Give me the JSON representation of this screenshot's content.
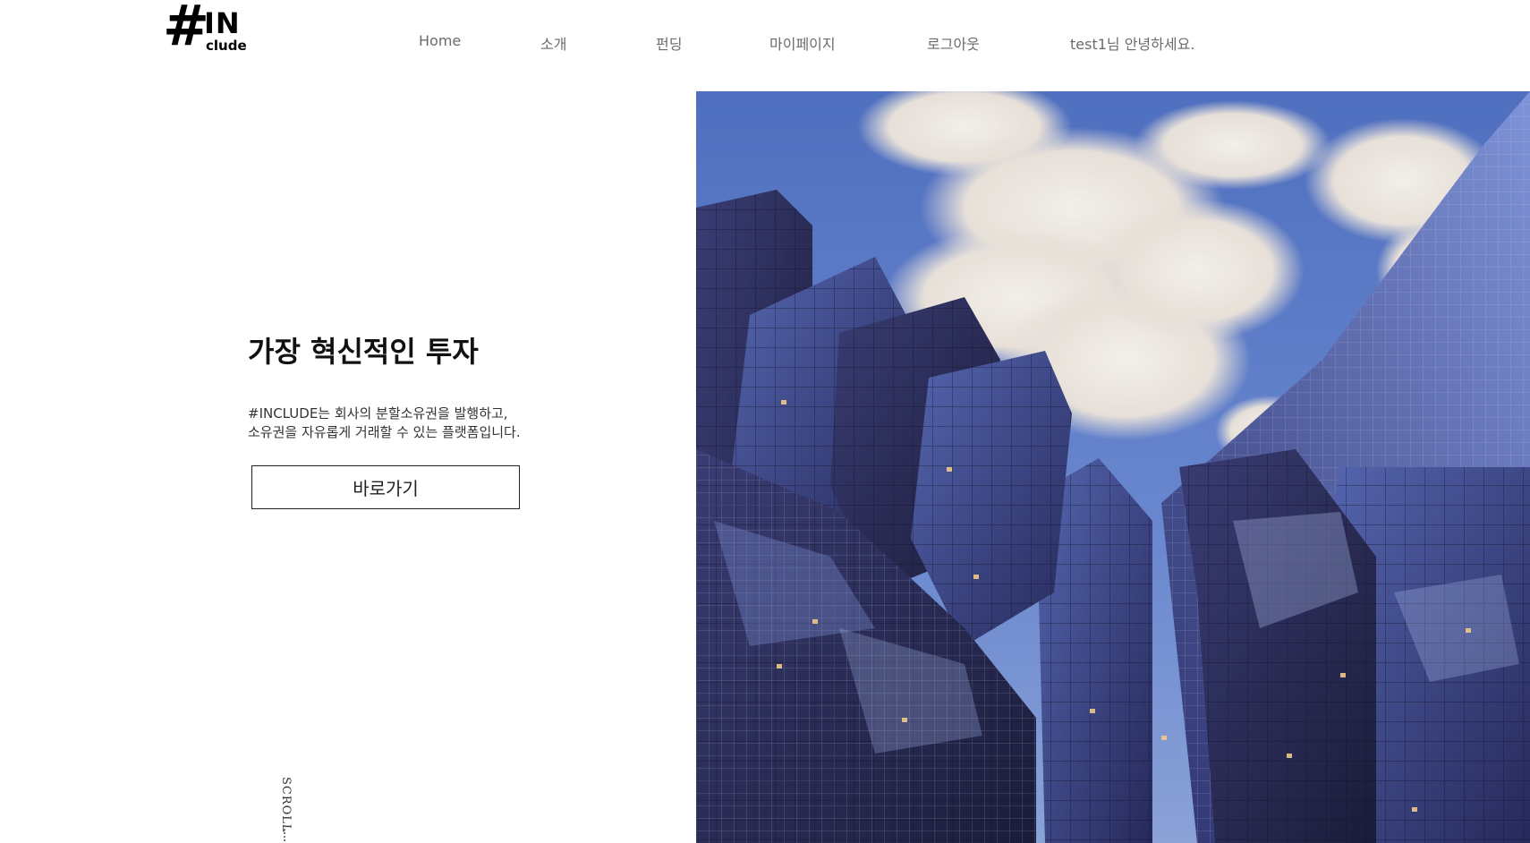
{
  "logo": {
    "hash": "#",
    "in": "IN",
    "clude": "clude"
  },
  "nav": {
    "items": [
      {
        "label": "Home"
      },
      {
        "label": "소개"
      },
      {
        "label": "펀딩"
      },
      {
        "label": "마이페이지"
      },
      {
        "label": "로그아웃"
      },
      {
        "label": "test1님 안녕하세요."
      }
    ]
  },
  "hero": {
    "title": "가장 혁신적인 투자",
    "description_line1": "#INCLUDE는 회사의 분할소유권을 발행하고,",
    "description_line2": "소유권을 자유롭게 거래할 수 있는 플랫폼입니다.",
    "cta_label": "바로가기",
    "scroll_label": "SCROLL"
  },
  "colors": {
    "background": "#ffffff",
    "text": "#222222",
    "nav_text": "#6b6b6b",
    "sky": "#5a78c4",
    "glass": "#2a2c55"
  }
}
